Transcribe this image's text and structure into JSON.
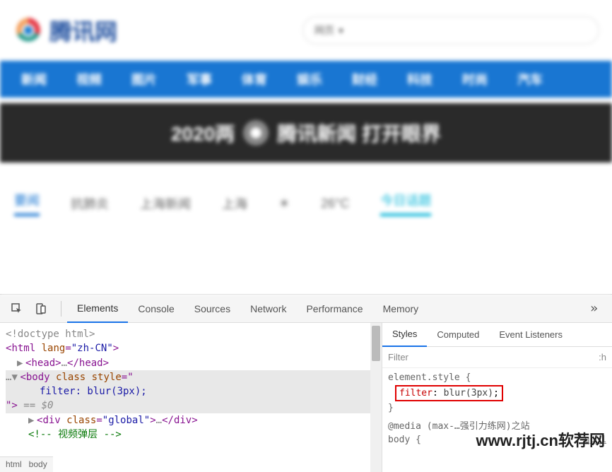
{
  "header": {
    "logo_text": "腾讯网",
    "search_label": "网页",
    "search_icon": "▾"
  },
  "nav": {
    "items": [
      "新闻",
      "视频",
      "图片",
      "军事",
      "体育",
      "娱乐",
      "财经",
      "科技",
      "时尚",
      "汽车"
    ]
  },
  "banner": {
    "left": "2020两",
    "right": "腾讯新闻 打开眼界"
  },
  "subtabs": {
    "items": [
      "要闻",
      "抗肺炎",
      "上海新闻"
    ],
    "weather_city": "上海",
    "weather_temp": "26°C",
    "topic": "今日话题"
  },
  "devtools": {
    "tabs": [
      "Elements",
      "Console",
      "Sources",
      "Network",
      "Performance",
      "Memory"
    ],
    "active_tab": "Elements",
    "more": "»",
    "elements": {
      "doctype": "<!doctype html>",
      "html_open": "html",
      "html_lang_attr": "lang",
      "html_lang_val": "\"zh-CN\"",
      "head": "head",
      "head_ellipsis": "…",
      "body_tag": "body",
      "body_class_attr": "class",
      "body_style_attr": "style",
      "body_style_val": "filter: blur(3px);",
      "sel_suffix": "== $0",
      "div_tag": "div",
      "div_class_attr": "class",
      "div_class_val": "\"global\"",
      "div_ellipsis": "…",
      "comment": "<!-- 视频弹层 -->",
      "sel_prefix": "…"
    },
    "breadcrumb": [
      "html",
      "body"
    ],
    "styles": {
      "tabs": [
        "Styles",
        "Computed",
        "Event Listeners"
      ],
      "active_tab": "Styles",
      "filter_placeholder": "Filter",
      "hov": ":h",
      "rule1_sel": "element.style {",
      "rule1_prop": "filter",
      "rule1_val": "blur(3px)",
      "rule1_close": "}",
      "rule2_media": "@media (max-…强引力练网)之站",
      "rule2_sel": "body {",
      "rule2_link": "qq_1"
    }
  },
  "watermark": "www.rjtj.cn软荐网"
}
